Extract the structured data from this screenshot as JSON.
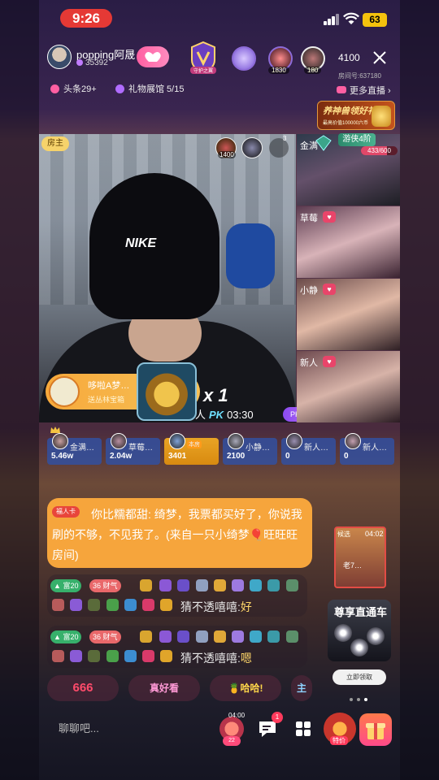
{
  "status_bar": {
    "time": "9:26",
    "battery": "63"
  },
  "header": {
    "host_name": "popping阿晟",
    "host_fans": "35392",
    "follow_icon": "heart-handshake-icon",
    "guard_badge_label": "守护之翼",
    "fan_counts": [
      "1830",
      "180"
    ],
    "viewer_count": "4100",
    "room_id": "房间号:637180",
    "tags": [
      {
        "label": "头条29+",
        "color": "#ff5fa2"
      },
      {
        "label": "礼物展馆 5/15",
        "color": "#b06cff"
      }
    ],
    "more_live": "更多直播",
    "promo_title": "养神兽领好礼",
    "promo_sub": "最高价值100000六币"
  },
  "video": {
    "host_tag": "房主",
    "top_avatar_count": "1400",
    "toggle_count": "3",
    "cap_logo": "NIKE",
    "gift_banner_name": "哆啦A梦…",
    "gift_banner_sub": "送丛林宝箱",
    "combo": "x 1",
    "pk_label_prefix": "人",
    "pk_logo": "PK",
    "pk_timer": "03:30",
    "pk_prop": "PK道具"
  },
  "side_rooms": [
    {
      "name": "金满",
      "rank_badge": "游侠4阶",
      "progress_text": "433/600",
      "progress": 0.72
    },
    {
      "name": "草莓"
    },
    {
      "name": "小静"
    },
    {
      "name": "新人"
    }
  ],
  "score_tiles": [
    {
      "name": "金满…",
      "value": "5.46w",
      "highlight": false
    },
    {
      "name": "草莓…",
      "value": "2.04w",
      "highlight": false
    },
    {
      "name": "",
      "badge": "本房",
      "value": "3401",
      "highlight": true
    },
    {
      "name": "小静…",
      "value": "2100",
      "highlight": false
    },
    {
      "name": "新人…",
      "value": "0",
      "highlight": false
    },
    {
      "name": "新人…",
      "value": "0",
      "highlight": false
    }
  ],
  "chat": {
    "bubble_tag": "福人卡",
    "bubble_text": "你比糯都甜: 绮梦，我票都买好了，你说我刷的不够，不见我了。(来自一只小绮梦🎈旺旺旺房间)",
    "lines": [
      {
        "level": "富20",
        "sub_level": "36",
        "sub_label": "财气",
        "user": "猜不透嘻嘻:",
        "content": "好"
      },
      {
        "level": "富20",
        "sub_level": "36",
        "sub_label": "财气",
        "user": "猜不透嘻嘻:",
        "content": "嗯"
      }
    ]
  },
  "side_panel": {
    "card_time": "04:02",
    "card_top_label": "候选",
    "card_label": "老7…",
    "car_title": "尊享直通车",
    "claim_button": "立即领取"
  },
  "quick_replies": [
    "666",
    "真好看",
    "🍍哈哈!",
    "主"
  ],
  "bottom_bar": {
    "input_placeholder": "聊聊吧...",
    "treasure_timer": "04:00",
    "treasure_count": "22",
    "message_badge": "1",
    "sale_label": "特价"
  },
  "colors": {
    "accent_pink": "#ff5fa2",
    "live_red": "#e53935",
    "bubble_orange": "#f6a53c",
    "score_blue": "#3250a0",
    "score_gold": "#e9a425"
  }
}
